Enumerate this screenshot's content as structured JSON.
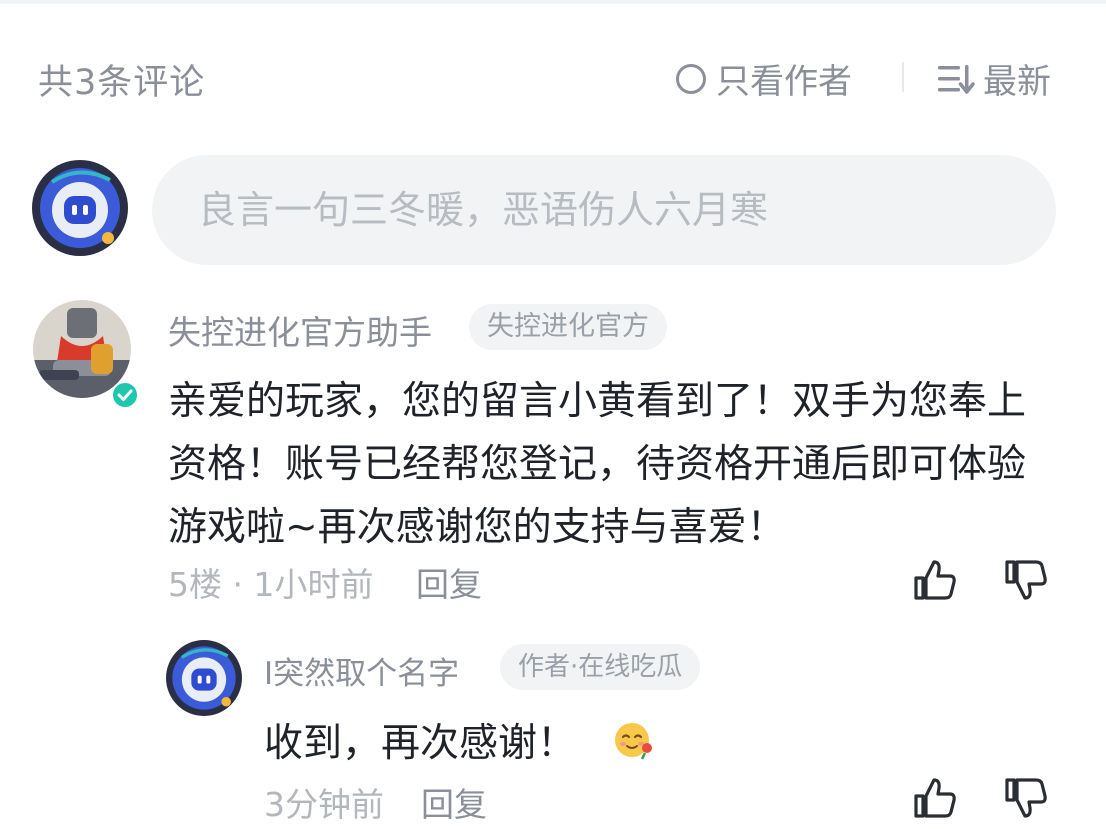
{
  "header": {
    "count_text": "共3条评论",
    "only_author_label": "只看作者",
    "sort_label": "最新"
  },
  "comment_input": {
    "placeholder": "良言一句三冬暖，恶语伤人六月寒"
  },
  "comment": {
    "author": "失控进化官方助手",
    "tag": "失控进化官方",
    "text": "亲爱的玩家，您的留言小黄看到了！双手为您奉上资格！账号已经帮您登记，待资格开通后即可体验游戏啦~再次感谢您的支持与喜爱！",
    "meta": "5楼 · 1小时前",
    "reply_label": "回复"
  },
  "reply": {
    "author": "I突然取个名字",
    "tag": "作者·在线吃瓜",
    "text": "收到，再次感谢！",
    "meta": "3分钟前",
    "reply_label": "回复"
  },
  "icons": {
    "only_author": "radio-circle-icon",
    "sort": "sort-list-icon",
    "like": "thumbs-up-icon",
    "dislike": "thumbs-down-icon",
    "verified": "verified-badge-icon",
    "emoji": "flower-emoji-icon"
  },
  "colors": {
    "accent_verified": "#1fc7b0",
    "avatar_blue": "#3b5bd8",
    "muted_text": "#8a8f99"
  }
}
